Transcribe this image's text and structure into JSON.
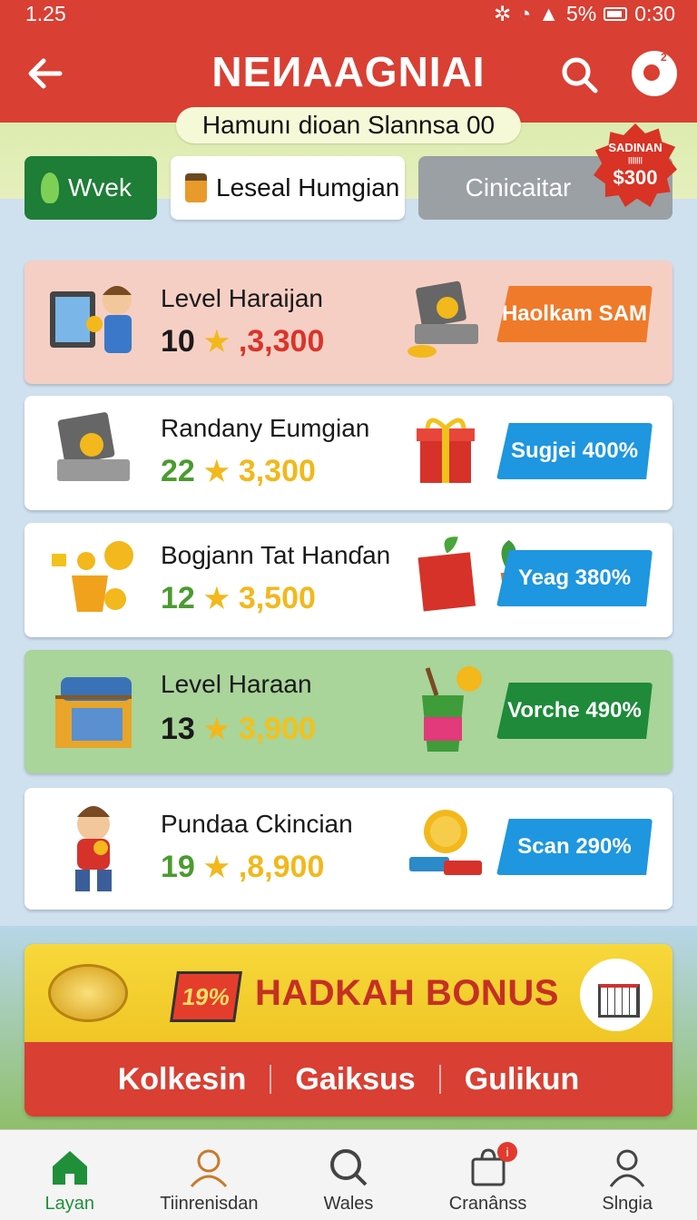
{
  "status": {
    "time": "1.25",
    "battery": "5%",
    "clock": "0:30"
  },
  "header": {
    "title": "NEИAAGNIAI",
    "promo_pill": "Hamunı dioan Slannsa 00"
  },
  "tabs": [
    {
      "label": "Wvek"
    },
    {
      "label": "Leseal Humgian"
    },
    {
      "label": "Cinicaitar"
    }
  ],
  "badge_burst": {
    "title": "SADINAN",
    "sub": "|||||||",
    "price": "$300"
  },
  "cards": [
    {
      "name": "Level Haraijan",
      "level": "10",
      "score": ",3,300",
      "tag": "Haolkam SAM",
      "tag_color": "#ef7a2a",
      "level_color": "#1a1a1a",
      "score_color": "#d9342a"
    },
    {
      "name": "Randany Eumgian",
      "level": "22",
      "score": "3,300",
      "tag": "Sugjei 400%",
      "tag_color": "#1e96e0",
      "level_color": "#4a9b2f",
      "score_color": "#f2b81c"
    },
    {
      "name": "Bogjann Tat Hanɗan",
      "level": "12",
      "score": "3,500",
      "tag": "Yeag 380%",
      "tag_color": "#1e96e0",
      "level_color": "#4a9b2f",
      "score_color": "#f2b81c"
    },
    {
      "name": "Level Haraan",
      "level": "13",
      "score": "3,900",
      "tag": "Vorche 490%",
      "tag_color": "#1e8a3a",
      "level_color": "#1a1a1a",
      "score_color": "#f2c21c"
    },
    {
      "name": "Pundaa Ckincian",
      "level": "19",
      "score": ",8,900",
      "tag": "Scan 290%",
      "tag_color": "#1e96e0",
      "level_color": "#4a9b2f",
      "score_color": "#f2b81c"
    }
  ],
  "bonus": {
    "badge": "19%",
    "title": "HADKAH BONUS",
    "links": [
      "Kolkesin",
      "Gaiksus",
      "Gulikun"
    ]
  },
  "nav": [
    {
      "label": "Layan",
      "icon": "home-icon"
    },
    {
      "label": "Tiinrenisdan",
      "icon": "profile-icon"
    },
    {
      "label": "Wales",
      "icon": "search-icon"
    },
    {
      "label": "Cranânss",
      "icon": "shopping-bag-icon",
      "badge": "i"
    },
    {
      "label": "Slngia",
      "icon": "user-icon"
    }
  ]
}
